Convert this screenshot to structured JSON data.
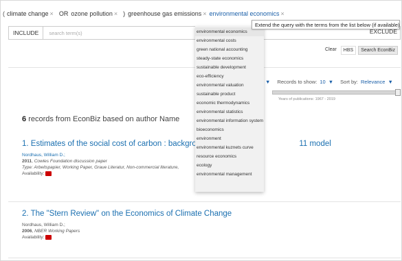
{
  "query": {
    "open_paren": "(",
    "terms": [
      {
        "label": "climate change",
        "remove": "×"
      },
      {
        "label": "OR"
      },
      {
        "label": "ozone pollution",
        "remove": "×"
      },
      {
        "label": ")"
      },
      {
        "label": "greenhouse gas emissions",
        "remove": "×"
      },
      {
        "label": "environmental economics",
        "remove": "×"
      }
    ]
  },
  "tooltip": "Extend the query with the terms from the list below (if available)",
  "input": {
    "include_label": "INCLUDE",
    "placeholder": "search term(s)",
    "exclude_label": "EXCLUDE"
  },
  "actions": {
    "clear": "Clear",
    "hbs": "HBS",
    "search": "Search EconBiz"
  },
  "controls": {
    "records_label": "Records to show:",
    "records_value": "10",
    "sort_label": "Sort by:",
    "sort_value": "Relevance",
    "arrow": "▼"
  },
  "years_label": "Years of publications: 1967 - 2019",
  "results": {
    "count": "6",
    "count_text": "records from EconBiz based on author Name"
  },
  "records": [
    {
      "title_start": "1. Estimates of the social cost of carbon : background and",
      "title_end": "11 model",
      "author": "Nordhaus, William D.;",
      "year": "2011",
      "source": "Cowles Foundation discussion paper",
      "type": "Type: Arbeitspapier, Working Paper, Graue Literatur, Non-commercial literature,",
      "availability": "Availability:"
    },
    {
      "title": "2. The \"Stern Review\" on the Economics of Climate Change",
      "author": "Nordhaus, William D.;",
      "year": "2006",
      "source": "NBER Working Papers",
      "availability": "Availability:"
    }
  ],
  "suggestions": [
    "environmental economics",
    "environmental costs",
    "green national accounting",
    "steady-state economics",
    "sustainable development",
    "eco-efficiency",
    "environmental valuation",
    "sustainable product",
    "economic thermodynamics",
    "environmental statistics",
    "environmental information system",
    "bioeconomics",
    "environment",
    "environmental kuznets curve",
    "resource economics",
    "ecology",
    "environmental management"
  ]
}
